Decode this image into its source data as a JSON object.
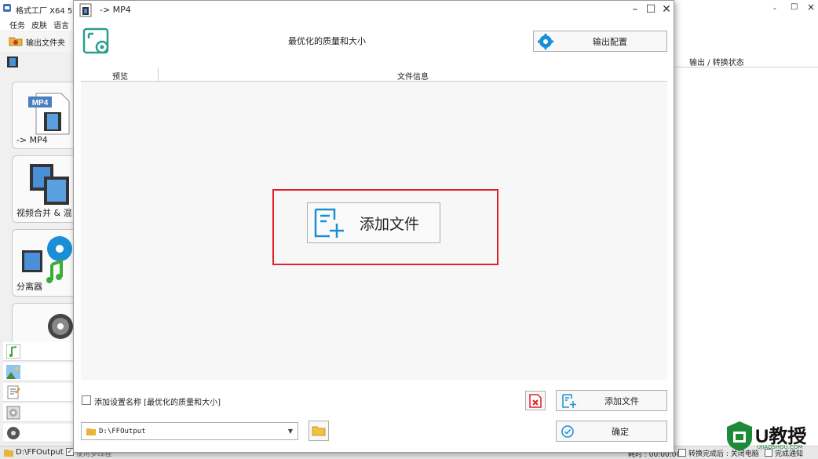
{
  "bg_app": {
    "title": "格式工厂 X64 5.2",
    "menu": [
      "任务",
      "皮肤",
      "语言"
    ],
    "toolbar_label": "输出文件夹",
    "right_header": "输出 / 转换状态",
    "right_controls": [
      "-",
      "□",
      "×"
    ],
    "sidebar": [
      {
        "label": "-> MP4",
        "icon": "mp4-video-icon",
        "badge": "MP4"
      },
      {
        "label": "视频合并 & 混",
        "icon": "video-merge-icon"
      },
      {
        "label": "分离器",
        "icon": "splitter-icon"
      },
      {
        "label": "",
        "icon": "disc-icon"
      }
    ],
    "mini_icons": [
      "music-icon",
      "picture-icon",
      "document-icon",
      "rom-icon",
      "utilities-icon"
    ],
    "status": {
      "path": "D:\\FFOutput",
      "left_check_label": "使用多线程",
      "elapsed": "耗时 : 00:00:00",
      "after_done": "转换完成后 : 关闭电脑",
      "notify": "完成通知"
    },
    "watermark": {
      "brand": "U教授",
      "url": "UJIAOSHOU.COM"
    }
  },
  "dialog": {
    "title": "-> MP4",
    "preset": "最优化的质量和大小",
    "output_config_button": "输出配置",
    "columns": [
      "预览",
      "文件信息"
    ],
    "center_add_button": "添加文件",
    "add_setting_label": "添加设置名称 [最优化的质量和大小]",
    "add_file_button": "添加文件",
    "output_path": "D:\\FFOutput",
    "ok_button": "确定"
  },
  "colors": {
    "accent": "#1a8fd6",
    "highlight": "#e0202a",
    "teal": "#2a9d8f",
    "watermark": "#1d8a3a"
  }
}
